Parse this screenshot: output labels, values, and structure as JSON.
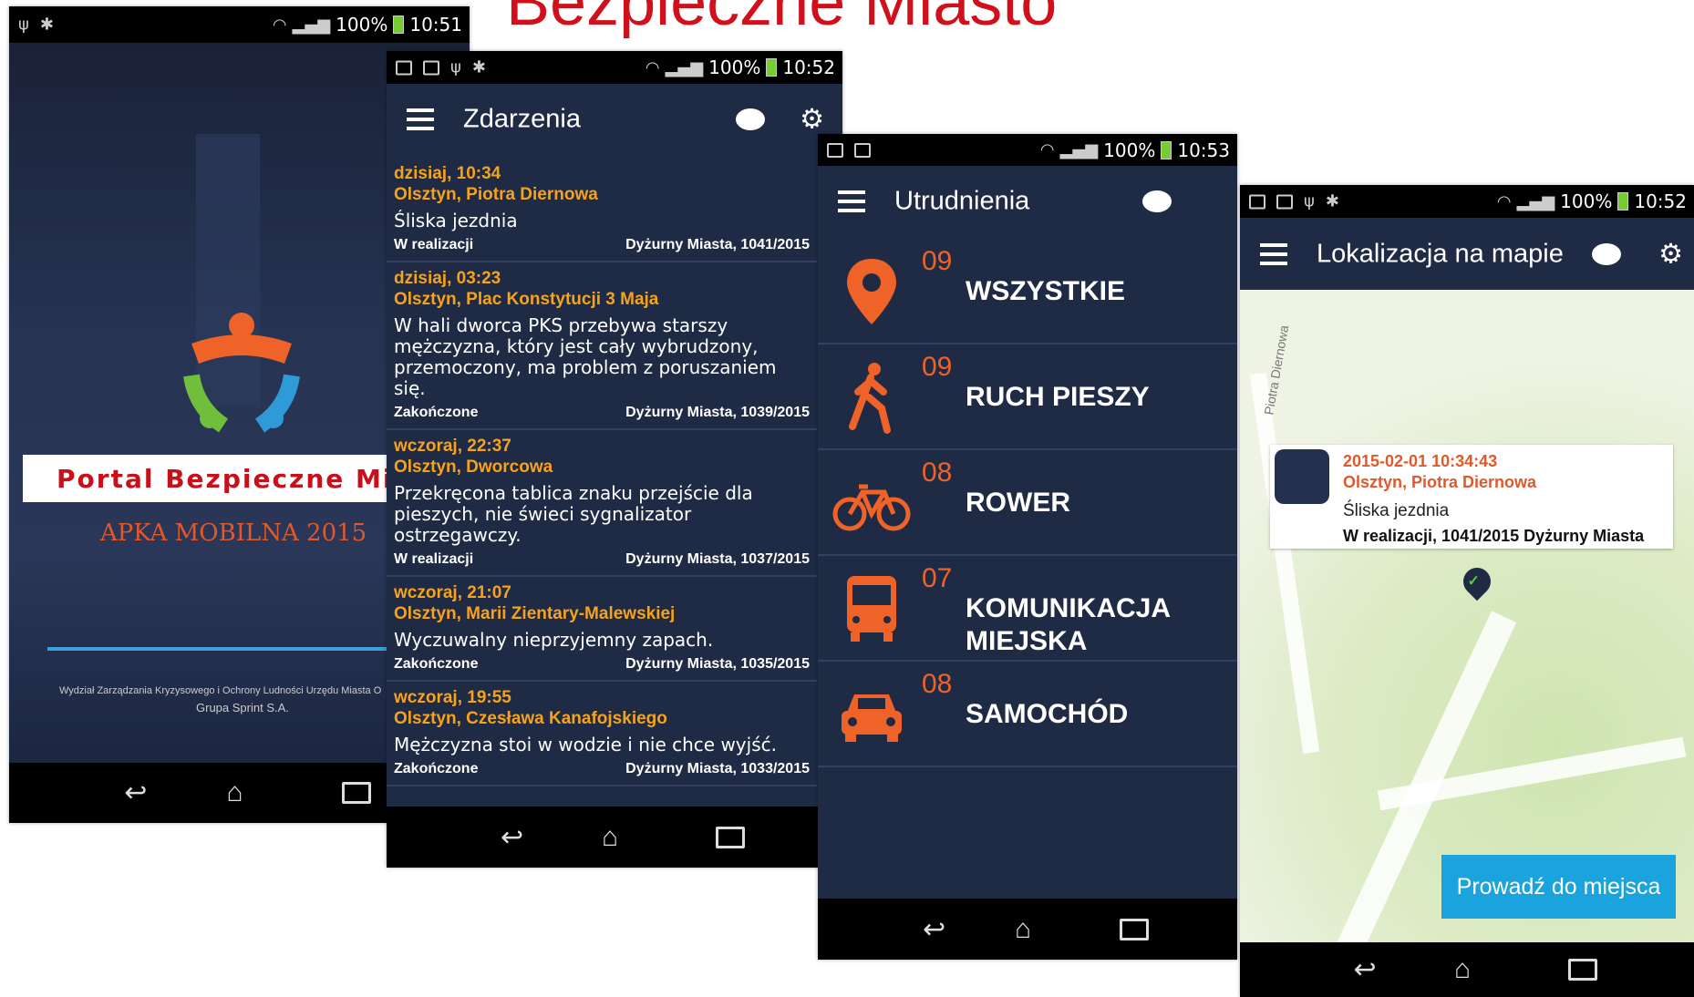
{
  "page_title": "Bezpieczne Miasto",
  "screen1": {
    "status": {
      "battery": "100%",
      "time": "10:51"
    },
    "banner": "Portal Bezpieczne Mias",
    "subtitle": "APKA MOBILNA 2015",
    "footer_line1": "Wydział Zarządzania Kryzysowego i Ochrony Ludności Urzędu Miasta O",
    "footer_line2": "Grupa Sprint S.A."
  },
  "screen2": {
    "status": {
      "battery": "100%",
      "time": "10:52"
    },
    "title": "Zdarzenia",
    "events": [
      {
        "when": "dzisiaj, 10:34",
        "where": "Olsztyn, Piotra Diernowa",
        "desc": "Śliska jezdnia",
        "state": "W realizacji",
        "ref": "Dyżurny Miasta, 1041/2015"
      },
      {
        "when": "dzisiaj, 03:23",
        "where": "Olsztyn, Plac Konstytucji 3 Maja",
        "desc": "W hali dworca PKS przebywa starszy mężczyzna, który jest cały wybrudzony, przemoczony, ma problem z poruszaniem się.",
        "state": "Zakończone",
        "ref": "Dyżurny Miasta, 1039/2015"
      },
      {
        "when": "wczoraj, 22:37",
        "where": "Olsztyn, Dworcowa",
        "desc": "Przekręcona tablica znaku przejście dla pieszych, nie świeci  sygnalizator ostrzegawczy.",
        "state": "W realizacji",
        "ref": "Dyżurny Miasta, 1037/2015"
      },
      {
        "when": "wczoraj, 21:07",
        "where": "Olsztyn, Marii Zientary-Malewskiej",
        "desc": "Wyczuwalny nieprzyjemny zapach.",
        "state": "Zakończone",
        "ref": "Dyżurny Miasta, 1035/2015"
      },
      {
        "when": "wczoraj, 19:55",
        "where": "Olsztyn, Czesława Kanafojskiego",
        "desc": "Mężczyzna stoi w wodzie i nie chce wyjść.",
        "state": "Zakończone",
        "ref": "Dyżurny Miasta, 1033/2015"
      }
    ]
  },
  "screen3": {
    "status": {
      "battery": "100%",
      "time": "10:53"
    },
    "title": "Utrudnienia",
    "categories": [
      {
        "count": "09",
        "label": "WSZYSTKIE",
        "icon": "location-pin-icon"
      },
      {
        "count": "09",
        "label": "RUCH PIESZY",
        "icon": "pedestrian-icon"
      },
      {
        "count": "08",
        "label": "ROWER",
        "icon": "bicycle-icon"
      },
      {
        "count": "07",
        "label": "KOMUNIKACJA MIEJSKA",
        "icon": "bus-icon"
      },
      {
        "count": "08",
        "label": "SAMOCHÓD",
        "icon": "car-icon"
      }
    ]
  },
  "screen4": {
    "status": {
      "battery": "100%",
      "time": "10:52"
    },
    "title": "Lokalizacja na mapie",
    "street_label": "Piotra Diernowa",
    "card": {
      "datetime": "2015-02-01 10:34:43",
      "place": "Olsztyn, Piotra Diernowa",
      "desc": "Śliska jezdnia",
      "status": "W realizacji, 1041/2015 Dyżurny Miasta"
    },
    "button": "Prowadź do miejsca"
  },
  "colors": {
    "accent_orange": "#f7a21b",
    "icon_orange": "#ef6228",
    "appbar": "#1f2a44",
    "title_red": "#d0101a",
    "button_blue": "#1aa3dc"
  }
}
